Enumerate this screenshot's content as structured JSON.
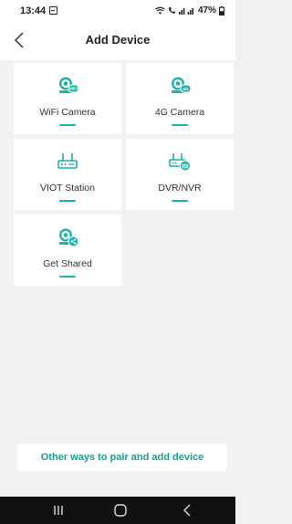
{
  "status_bar": {
    "time": "13:44",
    "battery": "47%",
    "notification_icon": "gallery-icon",
    "signal_icons": "wifi, call, signal"
  },
  "header": {
    "title": "Add Device",
    "back_icon": "chevron-left-icon"
  },
  "devices": [
    {
      "label": "WiFi Camera",
      "icon": "wifi-camera-icon",
      "badge": "WiFi"
    },
    {
      "label": "4G Camera",
      "icon": "4g-camera-icon",
      "badge": "4G"
    },
    {
      "label": "VIOT Station",
      "icon": "station-icon"
    },
    {
      "label": "DVR/NVR",
      "icon": "dvr-icon"
    },
    {
      "label": "Get Shared",
      "icon": "shared-camera-icon"
    }
  ],
  "other_ways_label": "Other ways to pair and add device",
  "colors": {
    "accent": "#1db3a5",
    "accent_text": "#1a9e93",
    "background": "#f2f2f2",
    "card": "#ffffff",
    "nav_bar": "#111111"
  }
}
